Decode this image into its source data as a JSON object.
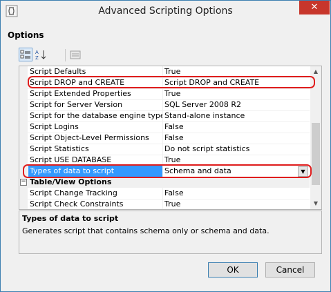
{
  "window": {
    "title": "Advanced Scripting Options",
    "close_glyph": "✕"
  },
  "options_label": "Options",
  "grid": {
    "rows": [
      {
        "name": "Script Defaults",
        "value": "True"
      },
      {
        "name": "Script DROP and CREATE",
        "value": "Script DROP and CREATE"
      },
      {
        "name": "Script Extended Properties",
        "value": "True"
      },
      {
        "name": "Script for Server Version",
        "value": "SQL Server 2008 R2"
      },
      {
        "name": "Script for the database engine type",
        "value": "Stand-alone instance"
      },
      {
        "name": "Script Logins",
        "value": "False"
      },
      {
        "name": "Script Object-Level Permissions",
        "value": "False"
      },
      {
        "name": "Script Statistics",
        "value": "Do not script statistics"
      },
      {
        "name": "Script USE DATABASE",
        "value": "True"
      },
      {
        "name": "Types of data to script",
        "value": "Schema and data"
      },
      {
        "name": "Table/View Options",
        "value": ""
      },
      {
        "name": "Script Change Tracking",
        "value": "False"
      },
      {
        "name": "Script Check Constraints",
        "value": "True"
      }
    ],
    "category_toggle": "−",
    "dropdown_glyph": "▼"
  },
  "description": {
    "title": "Types of data to script",
    "text": "Generates script that contains schema only or schema and data."
  },
  "buttons": {
    "ok": "OK",
    "cancel": "Cancel"
  },
  "colors": {
    "selection": "#3399ff",
    "highlight": "#e01d1d",
    "close": "#c7362b"
  }
}
